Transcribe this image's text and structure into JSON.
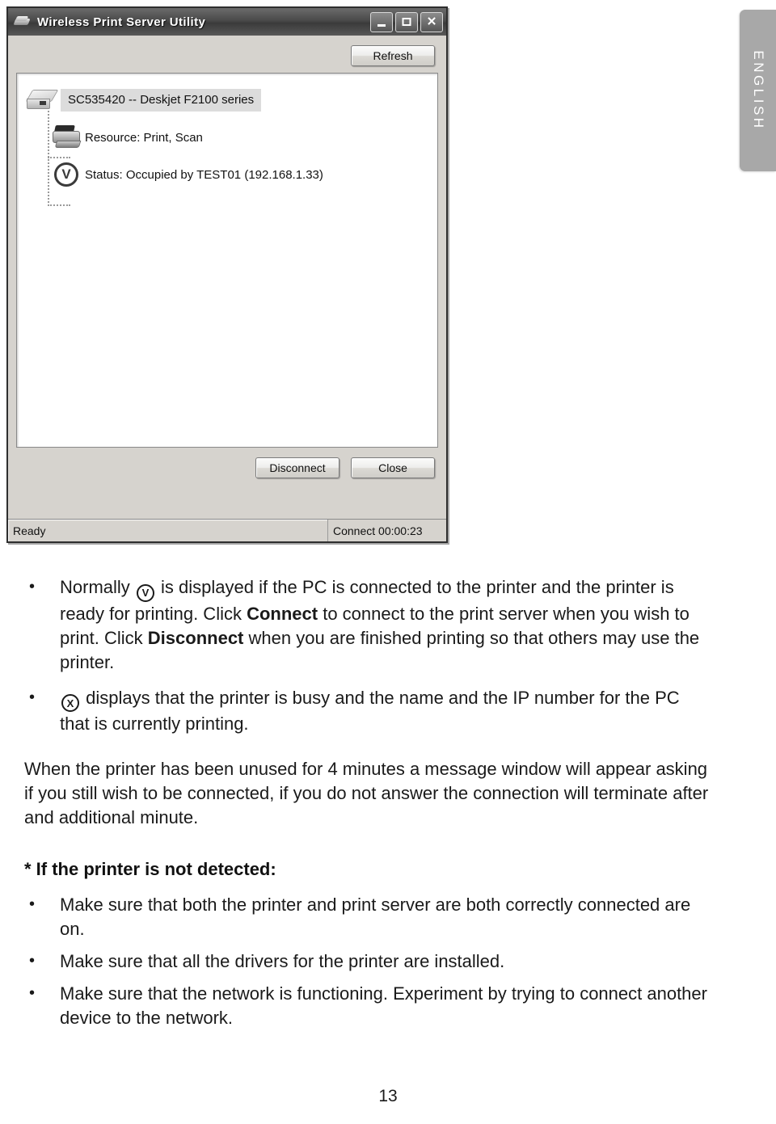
{
  "language_tab": {
    "label": "ENGLISH"
  },
  "window": {
    "title": "Wireless Print Server Utility",
    "app_icon": "print-server-icon",
    "controls": {
      "minimize": "–",
      "maximize": "□",
      "close": "✕"
    },
    "toolbar": {
      "refresh_label": "Refresh"
    },
    "tree": {
      "root": {
        "icon": "print-server-device-icon",
        "label": "SC535420 -- Deskjet F2100 series",
        "selected": true
      },
      "children": [
        {
          "icon": "printer-icon",
          "label": "Resource: Print, Scan"
        },
        {
          "icon": "circled-v-icon",
          "glyph": "V",
          "label": "Status: Occupied by TEST01 (192.168.1.33)"
        }
      ]
    },
    "buttons": {
      "disconnect_label": "Disconnect",
      "close_label": "Close"
    },
    "status_bar": {
      "left": "Ready",
      "right": "Connect 00:00:23"
    }
  },
  "document": {
    "bullets_top": [
      {
        "glyph": "V",
        "text_before": "Normally ",
        "text_after_1": " is displayed if the PC is connected to the printer and the printer is ready for printing. Click ",
        "bold_1": "Connect",
        "text_after_2": " to connect to the print server when you wish to print. Click ",
        "bold_2": "Disconnect",
        "text_after_3": " when you are finished printing so that others may use the printer."
      },
      {
        "glyph": "X",
        "text_after_1": " displays that the printer is busy and the name and the IP number for the PC that is currently printing."
      }
    ],
    "paragraph": "When the printer has been unused for 4 minutes a message window will appear asking if you still wish to be connected, if you do not answer the connection will terminate after and additional minute.",
    "heading": "* If the printer is not detected:",
    "bullets_bottom": [
      "Make sure that both the printer and print server are both correctly connected are on.",
      "Make sure that all the drivers for the printer are installed.",
      "Make sure that the network is functioning. Experiment by trying to connect another device to the network."
    ],
    "page_number": "13"
  }
}
